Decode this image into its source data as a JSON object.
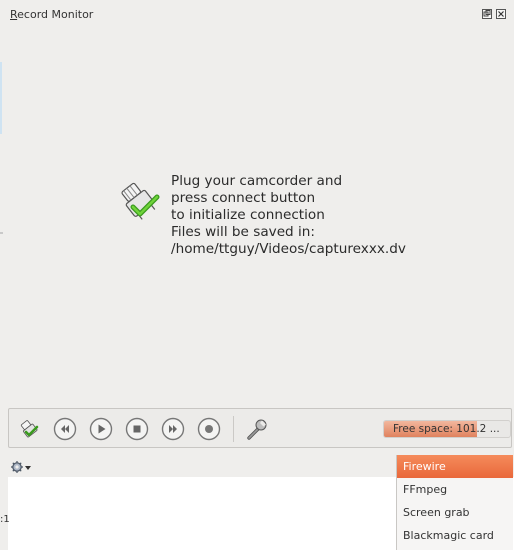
{
  "window": {
    "title_mnemonic": "R",
    "title_rest": "ecord Monitor",
    "float_icon": "float-window-icon",
    "close_icon": "close-window-icon"
  },
  "message": {
    "icon": "camcorder-connect-icon",
    "lines": [
      "Plug your camcorder and",
      "press connect button",
      "to initialize connection",
      "Files will be saved in:",
      "/home/ttguy/Videos/capturexxx.dv"
    ]
  },
  "toolbar": {
    "buttons": [
      {
        "name": "connect-button",
        "icon": "camcorder-connect-icon"
      },
      {
        "name": "rewind-button",
        "icon": "rewind-icon"
      },
      {
        "name": "play-button",
        "icon": "play-icon"
      },
      {
        "name": "stop-button",
        "icon": "stop-icon"
      },
      {
        "name": "forward-button",
        "icon": "forward-icon"
      },
      {
        "name": "record-button",
        "icon": "record-icon"
      },
      {
        "name": "configure-button",
        "icon": "wrench-icon"
      }
    ],
    "free_space_label": "Free space: 101.2 ...",
    "free_space_level": 0.74
  },
  "options_button": {
    "icon": "gear-dropdown-icon"
  },
  "left_fragment": ":1",
  "capture_device": {
    "options": [
      "Firewire",
      "FFmpeg",
      "Screen grab",
      "Blackmagic card"
    ],
    "selected": "Firewire"
  },
  "colors": {
    "accent": "#e9683b",
    "background": "#efeeec"
  }
}
